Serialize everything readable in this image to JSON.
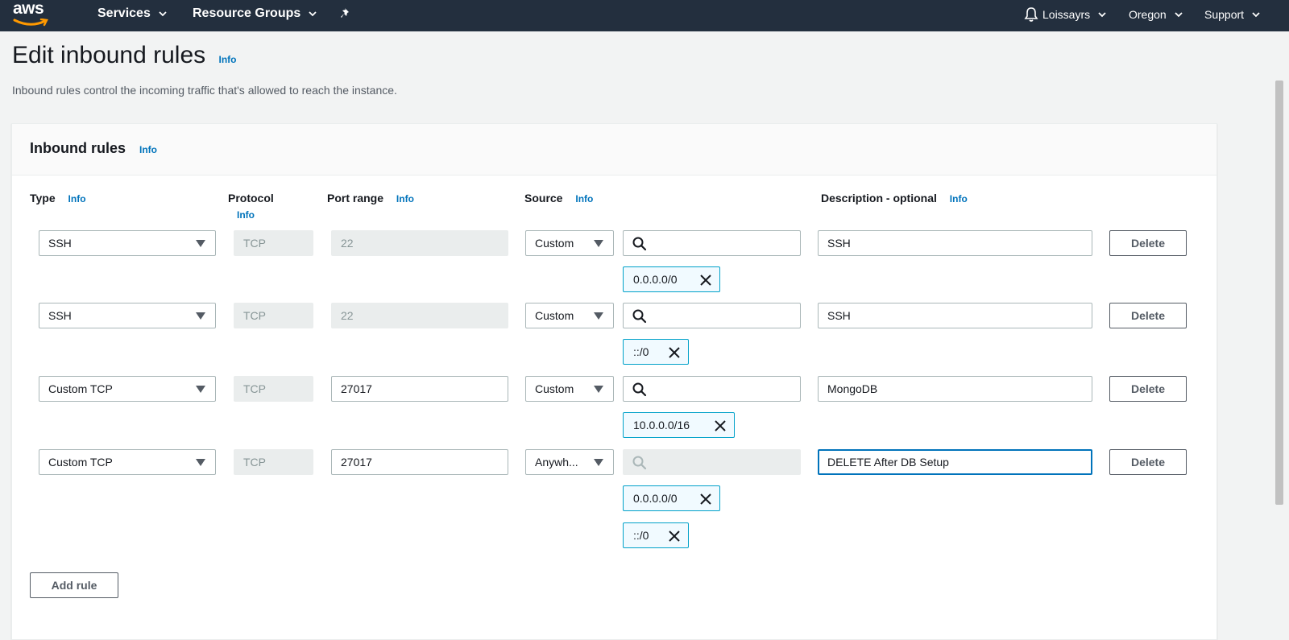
{
  "topbar": {
    "logo": "aws",
    "services": "Services",
    "resource_groups": "Resource Groups",
    "user": "Loissayrs",
    "region": "Oregon",
    "support": "Support"
  },
  "page": {
    "title": "Edit inbound rules",
    "info": "Info",
    "description": "Inbound rules control the incoming traffic that's allowed to reach the instance."
  },
  "panel": {
    "title": "Inbound rules",
    "info": "Info"
  },
  "columns": {
    "type": "Type",
    "protocol": "Protocol",
    "port_range": "Port range",
    "source": "Source",
    "description": "Description - optional",
    "info": "Info"
  },
  "rules": [
    {
      "type": "SSH",
      "protocol": "TCP",
      "port": "22",
      "source_type": "Custom",
      "tokens": [
        "0.0.0.0/0"
      ],
      "description": "SSH",
      "delete": "Delete"
    },
    {
      "type": "SSH",
      "protocol": "TCP",
      "port": "22",
      "source_type": "Custom",
      "tokens": [
        "::/0"
      ],
      "description": "SSH",
      "delete": "Delete"
    },
    {
      "type": "Custom TCP",
      "protocol": "TCP",
      "port": "27017",
      "source_type": "Custom",
      "tokens": [
        "10.0.0.0/16"
      ],
      "description": "MongoDB",
      "delete": "Delete"
    },
    {
      "type": "Custom TCP",
      "protocol": "TCP",
      "port": "27017",
      "source_type": "Anywh...",
      "tokens": [
        "0.0.0.0/0",
        "::/0"
      ],
      "description": "DELETE After DB Setup",
      "delete": "Delete"
    }
  ],
  "add_rule": "Add rule",
  "colors": {
    "topbar": "#232f3e",
    "link": "#0073bb",
    "token_border": "#00a1c9",
    "token_bg": "#f1faff"
  }
}
